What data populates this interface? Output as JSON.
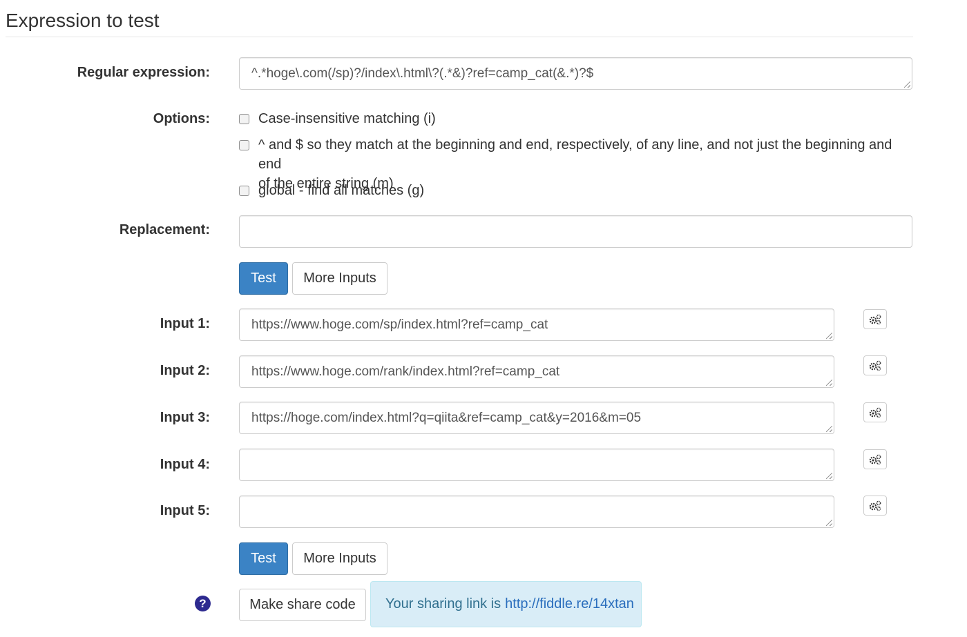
{
  "section_title": "Expression to test",
  "regex": {
    "label": "Regular expression:",
    "value": "^.*hoge\\.com(/sp)?/index\\.html\\?(.*&)?ref=camp_cat(&.*)?$"
  },
  "options": {
    "label": "Options:",
    "items": [
      {
        "text": "Case-insensitive matching (i)",
        "checked": false
      },
      {
        "text_line1": "^ and $ so they match at the beginning and end, respectively, of any line, and not just the beginning and end",
        "text_line2": "of the entire string (m)",
        "checked": false
      },
      {
        "text": "global - find all matches (g)",
        "checked": false
      }
    ]
  },
  "replacement": {
    "label": "Replacement:",
    "value": ""
  },
  "buttons": {
    "test": "Test",
    "more_inputs": "More Inputs",
    "share": "Make share code"
  },
  "inputs": [
    {
      "label": "Input 1:",
      "value": "https://www.hoge.com/sp/index.html?ref=camp_cat"
    },
    {
      "label": "Input 2:",
      "value": "https://www.hoge.com/rank/index.html?ref=camp_cat"
    },
    {
      "label": "Input 3:",
      "value": "https://hoge.com/index.html?q=qiita&ref=camp_cat&y=2016&m=05"
    },
    {
      "label": "Input 4:",
      "value": ""
    },
    {
      "label": "Input 5:",
      "value": ""
    }
  ],
  "help_icon": "question-circle-icon",
  "gear_icon": "gears-icon",
  "share": {
    "prefix": "Your sharing link is",
    "link": "http://fiddle.re/14xtan"
  },
  "colors": {
    "primary": "#3b83c5",
    "alert_bg": "#d9edf7",
    "alert_text": "#31708f",
    "link": "#2a6ebd",
    "help_icon": "#2d2a8f"
  }
}
